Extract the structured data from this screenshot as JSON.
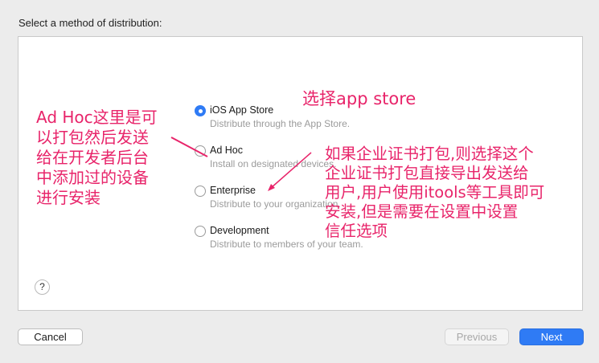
{
  "header": {
    "title": "Select a method of distribution:"
  },
  "options": [
    {
      "label": "iOS App Store",
      "description": "Distribute through the App Store.",
      "selected": true
    },
    {
      "label": "Ad Hoc",
      "description": "Install on designated devices.",
      "selected": false
    },
    {
      "label": "Enterprise",
      "description": "Distribute to your organization.",
      "selected": false
    },
    {
      "label": "Development",
      "description": "Distribute to members of your team.",
      "selected": false
    }
  ],
  "help": {
    "label": "?"
  },
  "buttons": {
    "cancel": "Cancel",
    "previous": "Previous",
    "next": "Next"
  },
  "annotations": {
    "app_store": "选择app store",
    "ad_hoc": "Ad Hoc这里是可\n以打包然后发送\n给在开发者后台\n中添加过的设备\n进行安装",
    "enterprise": "如果企业证书打包,则选择这个\n企业证书打包直接导出发送给\n用户,用户使用itools等工具即可\n安装,但是需要在设置中设置\n信任选项",
    "color": "#e8246a"
  },
  "colors": {
    "accent": "#2f7bf5"
  }
}
